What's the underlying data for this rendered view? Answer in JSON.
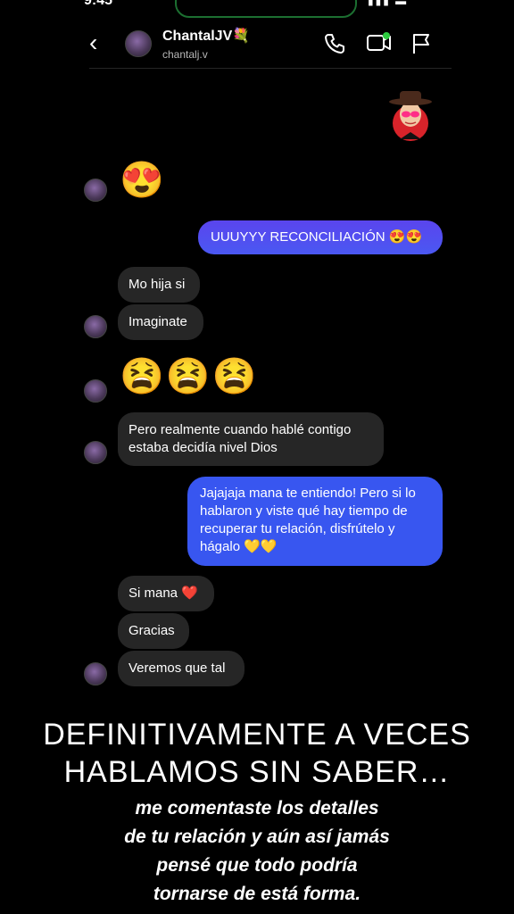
{
  "status": {
    "time": "9:45",
    "right": "▮▮▮ ▬"
  },
  "header": {
    "display_name": "ChantalJV💐",
    "username": "chantalj.v",
    "back_label": "‹"
  },
  "messages": [
    {
      "from": "them",
      "type": "emoji",
      "text": "😍"
    },
    {
      "from": "me",
      "text": "UUUYYY RECONCILIACIÓN 😍😍"
    },
    {
      "from": "them",
      "text": "Mo hija si"
    },
    {
      "from": "them",
      "text": "Imaginate"
    },
    {
      "from": "them",
      "type": "emoji",
      "text": "😫😫😫"
    },
    {
      "from": "them",
      "lines": [
        "Pero realmente cuando hablé contigo",
        "estaba decidía nivel Dios"
      ]
    },
    {
      "from": "me",
      "lines": [
        "Jajajaja mana te entiendo! Pero si lo",
        "hablaron y viste qué hay tiempo de",
        "recuperar tu relación, disfrútelo y",
        "hágalo 💛💛"
      ]
    },
    {
      "from": "them",
      "text": "Si mana ❤️"
    },
    {
      "from": "them",
      "text": "Gracias"
    },
    {
      "from": "them",
      "text": "Veremos que tal"
    }
  ],
  "caption": {
    "heading": [
      "DEFINITIVAMENTE A VECES",
      "HABLAMOS SIN SABER…"
    ],
    "sub": [
      "me comentaste los detalles",
      "de tu relación y aún así jamás",
      "pensé que todo podría",
      "tornarse de está forma."
    ]
  },
  "colors": {
    "bubble_them": "#262626",
    "bubble_me_top": "#5a45ee",
    "bubble_me_bottom": "#3856f0",
    "background": "#000000"
  },
  "icons": [
    "chevron-left-icon",
    "phone-icon",
    "video-icon",
    "flag-icon"
  ]
}
